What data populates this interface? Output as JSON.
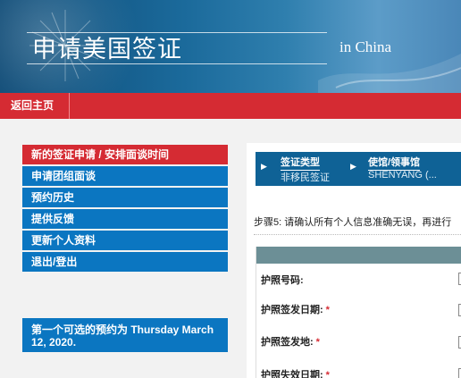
{
  "header": {
    "title": "申请美国签证",
    "subtitle": "in China"
  },
  "nav": {
    "home_label": "返回主页"
  },
  "sidebar": {
    "items": [
      {
        "label": "新的签证申请 / 安排面谈时间",
        "active": true
      },
      {
        "label": "申请团组面谈",
        "active": false
      },
      {
        "label": "预约历史",
        "active": false
      },
      {
        "label": "提供反馈",
        "active": false
      },
      {
        "label": "更新个人资料",
        "active": false
      },
      {
        "label": "退出/登出",
        "active": false
      }
    ],
    "notice": "第一个可选的预约为 Thursday March 12, 2020."
  },
  "steps": [
    {
      "label": "签证类型",
      "value": "非移民签证"
    },
    {
      "label": "使馆/领事馆",
      "value": "SHENYANG (..."
    }
  ],
  "instruction": "步骤5: 请确认所有个人信息准确无误，再进行",
  "form": {
    "fields": [
      {
        "label": "护照号码:",
        "required": false
      },
      {
        "label": "护照签发日期:",
        "required": true,
        "marker": "*"
      },
      {
        "label": "护照签发地:",
        "required": true,
        "marker": "*"
      },
      {
        "label": "护照失效日期:",
        "required": true,
        "marker": "*"
      }
    ]
  },
  "colors": {
    "nav_red": "#d52b33",
    "menu_blue": "#0b76c1",
    "steps_blue": "#0f6296",
    "form_header": "#6c8f96"
  }
}
